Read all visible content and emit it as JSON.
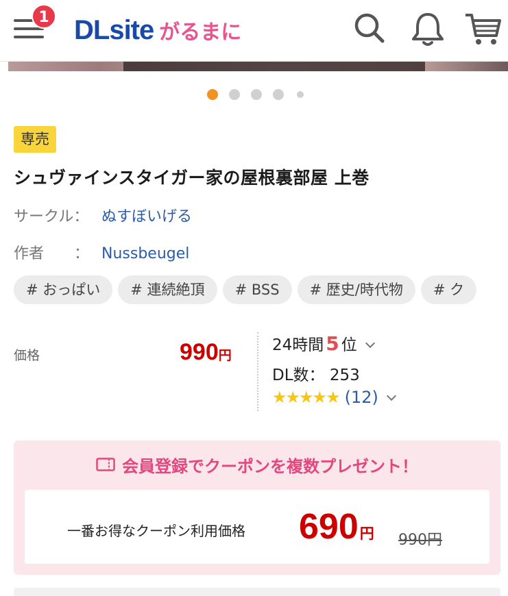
{
  "header": {
    "notification_count": "1",
    "logo_main": "DLsite",
    "logo_sub": "がるまに",
    "icons": [
      "menu-icon",
      "search-icon",
      "bell-icon",
      "cart-icon"
    ]
  },
  "carousel": {
    "slides": 5,
    "active_index": 0
  },
  "product": {
    "badge": "専売",
    "title": "シュヴァインスタイガー家の屋根裏部屋 上巻",
    "circle_label": "サークル：",
    "circle_value": "ぬすぼいげる",
    "author_label": "作者　　：",
    "author_value": "Nussbeugel",
    "tags": [
      "# おっぱい",
      "# 連続絶頂",
      "# BSS",
      "# 歴史/時代物",
      "# ク"
    ]
  },
  "pricing": {
    "price_label": "価格",
    "price_value": "990",
    "price_unit": "円",
    "rank_prefix": "24時間",
    "rank_value": "5",
    "rank_suffix": "位",
    "dl_label": "DL数：",
    "dl_value": "253",
    "stars": "★★★★★",
    "rating_count": "(12)",
    "rating": 5
  },
  "coupon": {
    "headline": "会員登録でクーポンを複数プレゼント！",
    "label": "一番お得なクーポン利用価格",
    "price": "690",
    "unit": "円",
    "original": "990円"
  },
  "colors": {
    "accent_red": "#cc0000",
    "link_blue": "#2a5ca8",
    "brand_pink": "#e8548f",
    "active_dot": "#f39122",
    "badge_yellow": "#f8d63b"
  }
}
